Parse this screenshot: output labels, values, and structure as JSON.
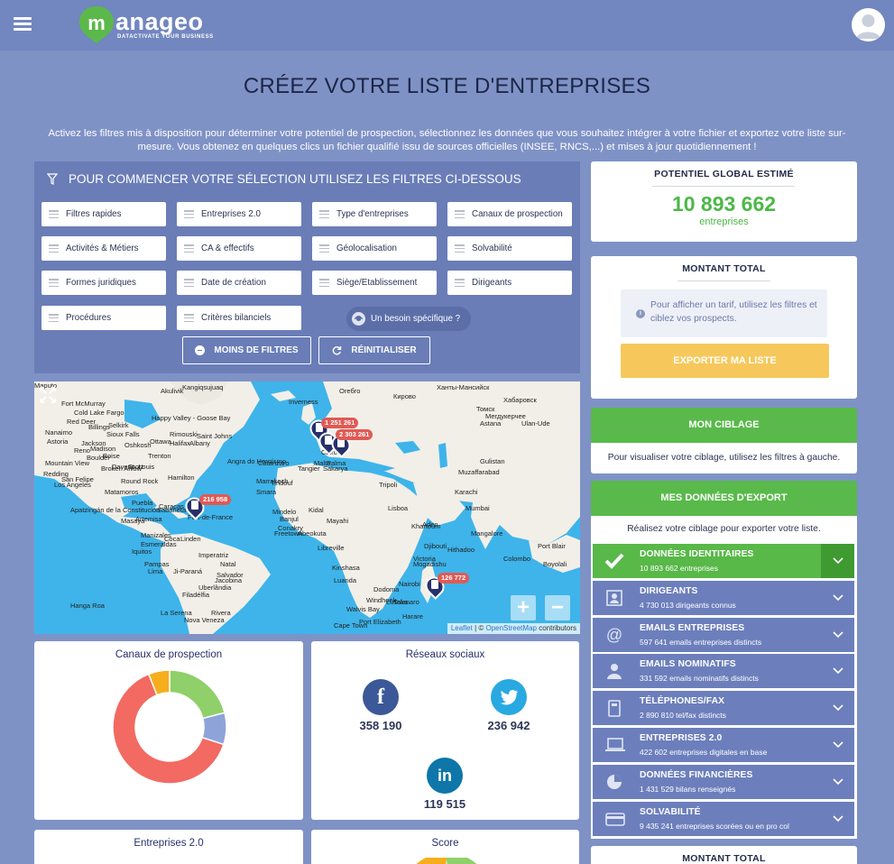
{
  "header": {
    "logo_text": "anageo",
    "logo_letter": "m",
    "logo_tagline": "DATACTIVATE YOUR BUSINESS"
  },
  "page": {
    "title": "CRÉEZ VOTRE LISTE D'ENTREPRISES",
    "intro": "Activez les filtres mis à disposition pour déterminer votre potentiel de prospection, sélectionnez les données que vous souhaitez intégrer à votre fichier et exportez votre liste sur-mesure. Vous obtenez en quelques clics un fichier qualifié issu de sources officielles (INSEE, RNCS,...) et mises à jour quotidiennement !"
  },
  "filters": {
    "heading": "POUR COMMENCER VOTRE SÉLECTION UTILISEZ LES FILTRES CI-DESSOUS",
    "items": [
      "Filtres rapides",
      "Entreprises 2.0",
      "Type d'entreprises",
      "Canaux de prospection",
      "Activités & Métiers",
      "CA & effectifs",
      "Géolocalisation",
      "Solvabilité",
      "Formes juridiques",
      "Date de création",
      "Siège/Etablissement",
      "Dirigeants",
      "Procédures",
      "Critères bilanciels"
    ],
    "need_label": "Un besoin spécifique ?",
    "less_label": "MOINS DE FILTRES",
    "reset_label": "RÉINITIALISER"
  },
  "map": {
    "labels": [
      "Akulivik",
      "Kangiqsujuaq",
      "Ханты-Мансийск",
      "Кирово",
      "Oreбro",
      "Fort McMurray",
      "Cold Lake",
      "Red Deer",
      "Fargo",
      "Nanaimo",
      "Astoria",
      "Billings",
      "Rimouski",
      "Happy Valley - Goose Bay",
      "Inverness",
      "Saint Johns",
      "Selkirk",
      "Sioux Falls",
      "Halifax",
      "Ottawa",
      "Oshkosh",
      "Trenton",
      "Madison",
      "Boise",
      "Jackson",
      "Reno",
      "Mountain View",
      "Davenport",
      "St. Louis",
      "Hamilton",
      "Redding",
      "Boulder",
      "Broken Arrow",
      "Albany",
      "Los Angeles",
      "San Felipe",
      "Round Rock",
      "Matamoros",
      "Apatzingán de la Constitución",
      "Sabaneta",
      "Puebla",
      "Masaya",
      "Artemisa",
      "Caracas",
      "Esmeraldas",
      "Manizales",
      "Coca",
      "Linden",
      "Iquitos",
      "Pampas",
      "Lima",
      "Imperatriz",
      "Natal",
      "Ji-Paraná",
      "Salvador",
      "Jacobina",
      "Uberlândia",
      "Filadélfia",
      "Rivera",
      "La Serena",
      "Hanga Roa",
      "Nova Veneza",
      "Fort-de-France",
      "Angra do Heroísmo",
      "Tangier",
      "Marrakech",
      "Tindouf",
      "Smara",
      "Mindelo",
      "Banjul",
      "Conakry",
      "Freetown",
      "Kidal",
      "Mayahi",
      "Abeokuta",
      "Libreville",
      "Kinshasa",
      "Luanda",
      "Walvis Bay",
      "Windhoek",
      "Cape Town",
      "Port Elizabeth",
      "Tolanaro",
      "Victoria",
      "Hithadoo",
      "Port Blair",
      "Boyolali",
      "Muzaffarabad",
      "Karachi",
      "Mumbai",
      "Colombo",
      "Mangalore",
      "Astana",
      "Ulan-Ude",
      "Хабаровск",
      "Томск",
      "Мегдукерчее",
      "Gulistan",
      "Sakarya",
      "Tripoli",
      "Cairo",
      "Malta",
      "Palma",
      "Catanzaro",
      "Lisboa",
      "Khartoum",
      "Aden",
      "Djibouti",
      "Mogadishu",
      "Nairobi",
      "Dodoma",
      "Lusaka",
      "Harare",
      "Maputo"
    ],
    "markers": [
      "1 251 261",
      "2 303 261",
      "216 958",
      "126 772"
    ],
    "attribution_leaflet": "Leaflet",
    "attribution_sep": " | © ",
    "attribution_osm": "OpenStreetMap",
    "attribution_tail": " contributors",
    "zoom_in": "+",
    "zoom_out": "−"
  },
  "canaux": {
    "title": "Canaux de prospection",
    "chart_data": {
      "type": "pie",
      "values": [
        21,
        9,
        64,
        6
      ],
      "colors": [
        "#8fd06a",
        "#8ea3d8",
        "#f26a61",
        "#f6ae1c"
      ]
    }
  },
  "reseaux": {
    "title": "Réseaux sociaux",
    "facebook": "358 190",
    "twitter": "236 942",
    "linkedin": "119 515",
    "facebook_icon": "f",
    "twitter_icon": "twitter-bird",
    "linkedin_icon": "in"
  },
  "bottom_cards": {
    "entreprises": "Entreprises 2.0",
    "score": "Score"
  },
  "potentiel": {
    "title": "POTENTIEL GLOBAL ESTIMÉ",
    "value": "10 893 662",
    "unit": "entreprises"
  },
  "montant": {
    "title": "MONTANT TOTAL",
    "info": "Pour afficher un tarif, utilisez les filtres et ciblez vos prospects.",
    "export": "EXPORTER MA LISTE"
  },
  "ciblage": {
    "title": "MON CIBLAGE",
    "text": "Pour visualiser votre ciblage, utilisez les filtres à gauche."
  },
  "export_data": {
    "title": "MES DONNÉES D'EXPORT",
    "text": "Réalisez votre ciblage pour exporter votre liste.",
    "rows": [
      {
        "title": "DONNÉES IDENTITAIRES",
        "sub": "10 893 662 entreprises"
      },
      {
        "title": "DIRIGEANTS",
        "sub": "4 730 013 dirigeants connus"
      },
      {
        "title": "EMAILS ENTREPRISES",
        "sub": "597 641 emails entreprises distincts"
      },
      {
        "title": "EMAILS NOMINATIFS",
        "sub": "331 592 emails nominatifs distincts"
      },
      {
        "title": "TÉLÉPHONES/FAX",
        "sub": "2 890 810 tel/fax distincts"
      },
      {
        "title": "ENTREPRISES 2.0",
        "sub": "422 602 entreprises digitales en base"
      },
      {
        "title": "DONNÉES FINANCIÈRES",
        "sub": "1 431 529 bilans renseignés"
      },
      {
        "title": "SOLVABILITÉ",
        "sub": "9 435 241 entreprises scorées ou en pro col"
      }
    ]
  },
  "montant2": {
    "title": "MONTANT TOTAL"
  },
  "colors": {
    "page_bg": "#7f92c6",
    "panel": "#6a7db7",
    "green": "#59b94a",
    "yellow": "#f6c85c",
    "facebook": "#3b5998",
    "twitter": "#29a9e1",
    "linkedin": "#0e76a8"
  }
}
